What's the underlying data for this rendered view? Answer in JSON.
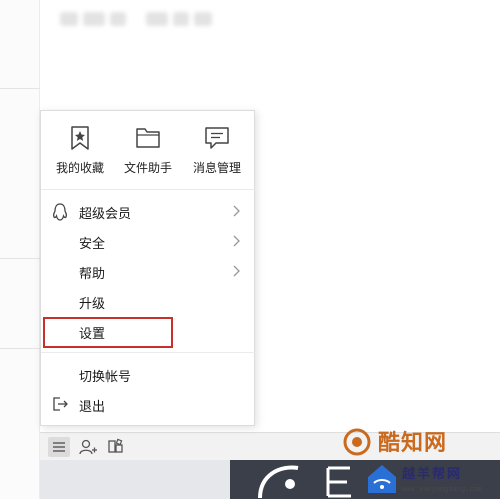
{
  "quick_actions": [
    {
      "label": "我的收藏",
      "icon": "star-bookmark-icon"
    },
    {
      "label": "文件助手",
      "icon": "folder-icon"
    },
    {
      "label": "消息管理",
      "icon": "message-icon"
    }
  ],
  "menu": {
    "items": [
      {
        "label": "超级会员",
        "has_submenu": true,
        "icon": "penguin-icon"
      },
      {
        "label": "安全",
        "has_submenu": true
      },
      {
        "label": "帮助",
        "has_submenu": true
      },
      {
        "label": "升级",
        "has_submenu": false
      },
      {
        "label": "设置",
        "has_submenu": false,
        "highlighted": true
      },
      {
        "label": "切换帐号",
        "has_submenu": false
      },
      {
        "label": "退出",
        "has_submenu": false,
        "icon": "logout-icon"
      }
    ]
  },
  "bottom_bar": {
    "icons": [
      "menu-icon",
      "add-contact-icon",
      "app-manager-icon"
    ]
  },
  "watermark": {
    "brand1": "酷知网",
    "brand2": "越羊帮网",
    "url": "www.yueyangbang.com"
  },
  "colors": {
    "highlight": "#c9302c",
    "popup_bg": "#ffffff",
    "taskbar_dark": "#3b3f49"
  }
}
